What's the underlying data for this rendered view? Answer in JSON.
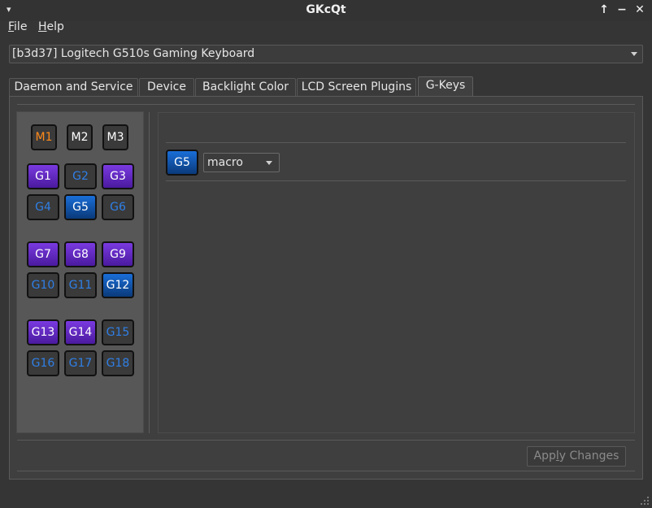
{
  "window": {
    "title": "GKcQt",
    "menu_glyph": "▾",
    "buttons": {
      "up": "↑",
      "minimize": "−",
      "close": "✕"
    }
  },
  "menubar": {
    "file": {
      "mnemonic": "F",
      "rest": "ile"
    },
    "help": {
      "mnemonic": "H",
      "rest": "elp"
    }
  },
  "device_select": {
    "value": "[b3d37] Logitech G510s Gaming Keyboard"
  },
  "tabs": [
    {
      "label": "Daemon and Service",
      "active": false
    },
    {
      "label": "Device",
      "active": false
    },
    {
      "label": "Backlight Color",
      "active": false
    },
    {
      "label": "LCD Screen Plugins",
      "active": false
    },
    {
      "label": "G-Keys",
      "active": true
    }
  ],
  "mkeys": [
    {
      "label": "M1",
      "state": "active"
    },
    {
      "label": "M2",
      "state": "normal"
    },
    {
      "label": "M3",
      "state": "normal"
    }
  ],
  "gkeys": [
    {
      "label": "G1",
      "style": "purple"
    },
    {
      "label": "G2",
      "style": "unset"
    },
    {
      "label": "G3",
      "style": "purple"
    },
    {
      "label": "G4",
      "style": "unset"
    },
    {
      "label": "G5",
      "style": "selected"
    },
    {
      "label": "G6",
      "style": "unset"
    },
    {
      "label": "G7",
      "style": "purple"
    },
    {
      "label": "G8",
      "style": "purple"
    },
    {
      "label": "G9",
      "style": "purple"
    },
    {
      "label": "G10",
      "style": "unset"
    },
    {
      "label": "G11",
      "style": "unset"
    },
    {
      "label": "G12",
      "style": "selected"
    },
    {
      "label": "G13",
      "style": "purple"
    },
    {
      "label": "G14",
      "style": "purple"
    },
    {
      "label": "G15",
      "style": "unset"
    },
    {
      "label": "G16",
      "style": "unset"
    },
    {
      "label": "G17",
      "style": "unset"
    },
    {
      "label": "G18",
      "style": "unset"
    }
  ],
  "editor": {
    "selected_key": "G5",
    "action_value": "macro"
  },
  "footer": {
    "apply_prefix": "App",
    "apply_mnemonic": "l",
    "apply_suffix": "y Changes"
  },
  "colors": {
    "background": "#353535",
    "gkey_assigned": "#6a2fd0",
    "gkey_selected": "#1a6ed8",
    "gkey_unset_text": "#2f7fe6",
    "mkey_active_text": "#ff8a1a"
  }
}
